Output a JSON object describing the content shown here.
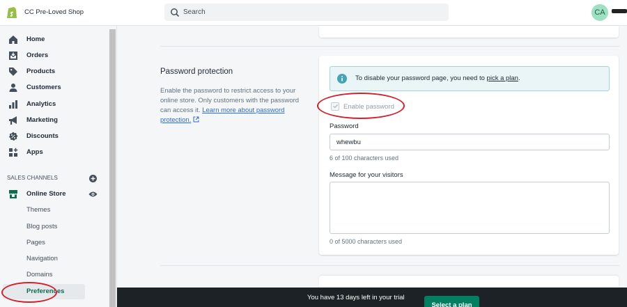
{
  "header": {
    "shop_name": "CC Pre-Loved Shop",
    "search_placeholder": "Search",
    "avatar_initials": "CA"
  },
  "sidebar": {
    "items": [
      {
        "label": "Home",
        "icon": "home-icon"
      },
      {
        "label": "Orders",
        "icon": "orders-icon"
      },
      {
        "label": "Products",
        "icon": "tag-icon"
      },
      {
        "label": "Customers",
        "icon": "person-icon"
      },
      {
        "label": "Analytics",
        "icon": "bar-chart-icon"
      },
      {
        "label": "Marketing",
        "icon": "megaphone-icon"
      },
      {
        "label": "Discounts",
        "icon": "discount-icon"
      },
      {
        "label": "Apps",
        "icon": "apps-icon"
      }
    ],
    "sales_channels_title": "SALES CHANNELS",
    "online_store_label": "Online Store",
    "sub_items": [
      "Themes",
      "Blog posts",
      "Pages",
      "Navigation",
      "Domains",
      "Preferences"
    ]
  },
  "password_section": {
    "heading": "Password protection",
    "description": "Enable the password to restrict access to your online store. Only customers with the password can access it.",
    "learn_more_link": "Learn more about password protection.",
    "banner_text": "To disable your password page, you need to",
    "banner_link": "pick a plan",
    "banner_period": ".",
    "checkbox_label": "Enable password",
    "checkbox_checked": true,
    "password_label": "Password",
    "password_value": "whewbu",
    "password_helper": "6 of 100 characters used",
    "message_label": "Message for your visitors",
    "message_value": "",
    "message_helper": "0 of 5000 characters used"
  },
  "trial_bar": {
    "text": "You have 13 days left in your trial",
    "button_label": "Select a plan"
  },
  "colors": {
    "accent": "#008060",
    "annotation_red": "#d41e2a",
    "banner_bg": "#e9f5f7",
    "info_icon": "#47a4b7"
  }
}
